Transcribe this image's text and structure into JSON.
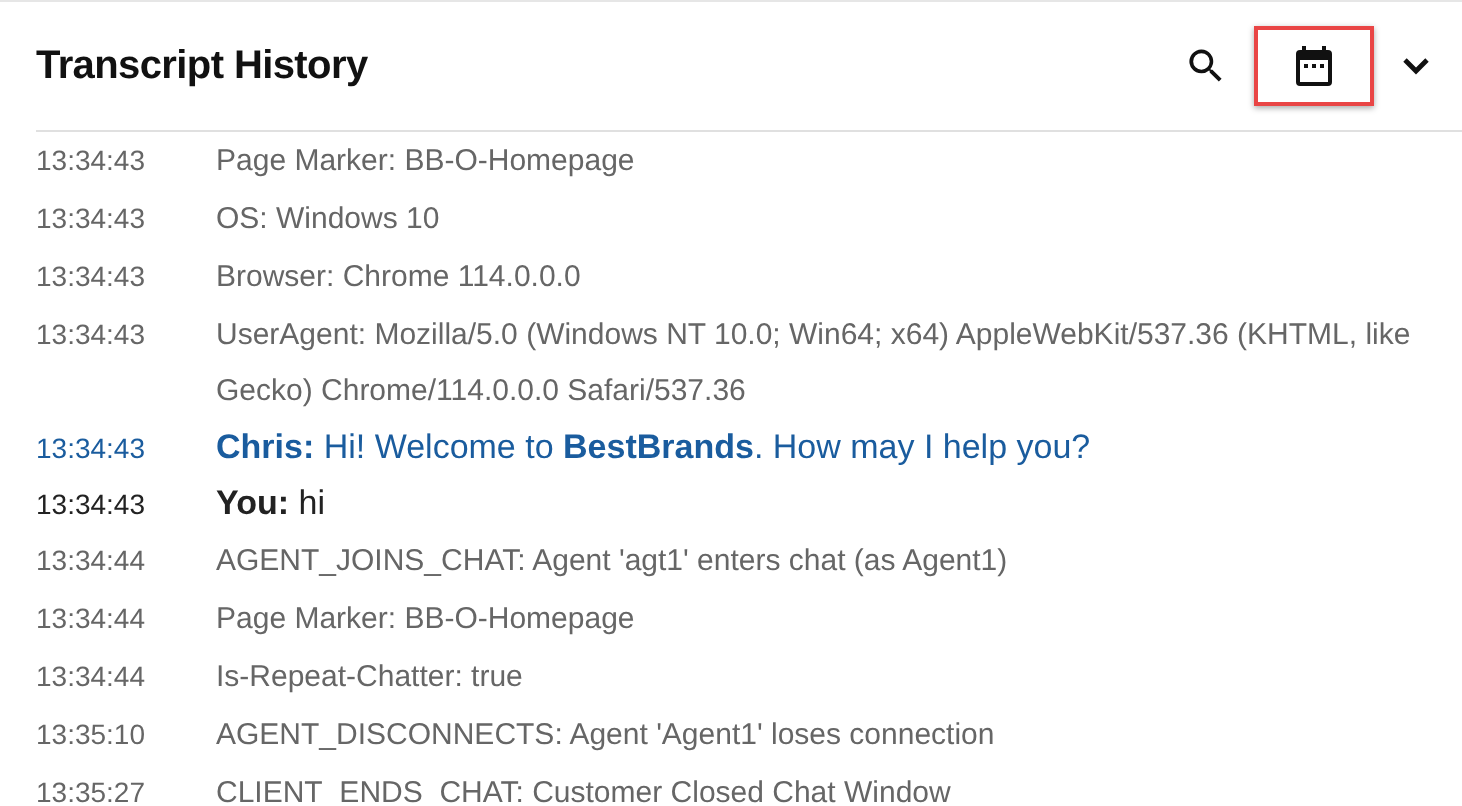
{
  "header": {
    "title": "Transcript History",
    "actions": [
      {
        "kind": "search",
        "highlighted": false
      },
      {
        "kind": "calendar",
        "highlighted": true
      },
      {
        "kind": "chevron",
        "highlighted": false
      }
    ]
  },
  "entries": [
    {
      "kind": "system",
      "time": "13:34:43",
      "text": "Page Marker: BB-O-Homepage"
    },
    {
      "kind": "system",
      "time": "13:34:43",
      "text": "OS: Windows 10"
    },
    {
      "kind": "system",
      "time": "13:34:43",
      "text": "Browser: Chrome 114.0.0.0"
    },
    {
      "kind": "system",
      "time": "13:34:43",
      "text": "UserAgent: Mozilla/5.0 (Windows NT 10.0; Win64; x64) AppleWebKit/537.36 (KHTML, like Gecko) Chrome/114.0.0.0 Safari/537.36"
    },
    {
      "kind": "agent",
      "time": "13:34:43",
      "text": "**Chris:** Hi! Welcome to **BestBrands**. How may I help you?"
    },
    {
      "kind": "visitor",
      "time": "13:34:43",
      "text": "**You:** hi"
    },
    {
      "kind": "system",
      "time": "13:34:44",
      "text": "AGENT_JOINS_CHAT: Agent 'agt1' enters chat (as Agent1)"
    },
    {
      "kind": "system",
      "time": "13:34:44",
      "text": "Page Marker: BB-O-Homepage"
    },
    {
      "kind": "system",
      "time": "13:34:44",
      "text": "Is-Repeat-Chatter: true"
    },
    {
      "kind": "system",
      "time": "13:35:10",
      "text": "AGENT_DISCONNECTS: Agent 'Agent1' loses connection"
    },
    {
      "kind": "system",
      "time": "13:35:27",
      "text": "CLIENT_ENDS_CHAT: Customer Closed Chat Window"
    }
  ]
}
